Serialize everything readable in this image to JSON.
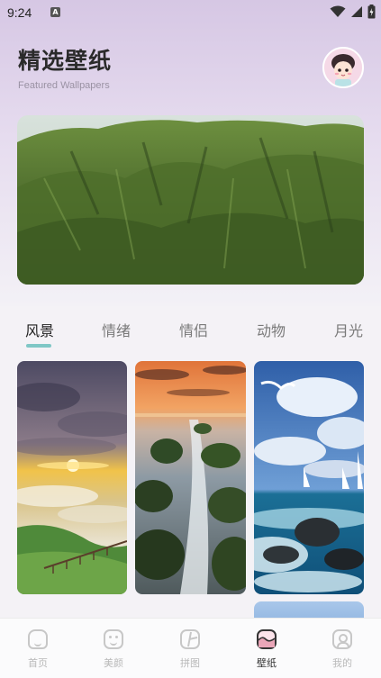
{
  "status": {
    "time": "9:24",
    "notif_letter": "A"
  },
  "header": {
    "title": "精选壁纸",
    "subtitle": "Featured Wallpapers"
  },
  "tabs": [
    "风景",
    "情绪",
    "情侣",
    "动物",
    "月光"
  ],
  "active_tab": 0,
  "bottom_nav": [
    {
      "label": "首页",
      "icon": "home-icon"
    },
    {
      "label": "美颜",
      "icon": "beauty-face-icon"
    },
    {
      "label": "拼图",
      "icon": "collage-icon"
    },
    {
      "label": "壁纸",
      "icon": "wallpaper-icon"
    },
    {
      "label": "我的",
      "icon": "profile-icon"
    }
  ],
  "active_nav": 3,
  "colors": {
    "accent": "#7fc7c6",
    "wallpaper_icon": "#e9a6b8"
  }
}
